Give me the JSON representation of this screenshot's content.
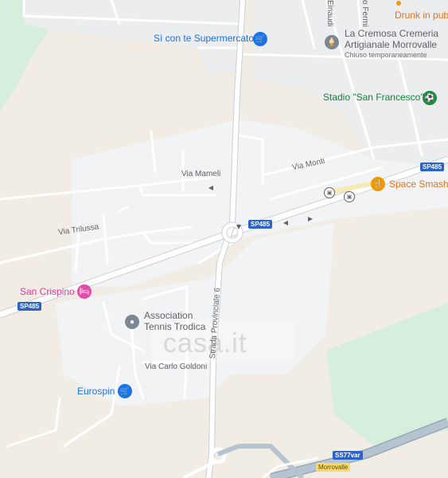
{
  "pois": {
    "supermercato": {
      "name": "Sì con te Supermercato",
      "color": "#1a73e8"
    },
    "cremeria": {
      "name_line1": "La Cremosa Cremeria",
      "name_line2": "Artigianale Morrovalle",
      "status": "Chiuso temporaneamente"
    },
    "drunk": {
      "name": "Drunk in publ"
    },
    "stadio": {
      "name": "Stadio \"San Francesco\""
    },
    "space_smash": {
      "name": "Space Smash"
    },
    "san_crispino": {
      "name": "San Crispino"
    },
    "tennis": {
      "name_line1": "Association",
      "name_line2": "Tennis Trodica"
    },
    "eurospin": {
      "name": "Eurospin"
    }
  },
  "streets": {
    "einaudi": "Einaudi",
    "fermi": "o Fermi",
    "mameli": "Via Mameli",
    "monti": "Via Monti",
    "trilussa": "Via Trilussa",
    "provinciale": "Strada Provinciale 6",
    "goldoni": "Via Carlo Goldoni"
  },
  "shields": {
    "sp485_a": "SP485",
    "sp485_b": "SP485",
    "sp485_c": "SP485",
    "ss77": "SS77var",
    "morrovalle": "Morrovalle"
  },
  "watermark": "casa.it",
  "colors": {
    "land": "#f1ece4",
    "urban": "#f1f3f4",
    "park": "#d6efdc",
    "road": "#ffffff",
    "road_outline": "#c9d1d8",
    "highway": "#a9b7c4"
  }
}
